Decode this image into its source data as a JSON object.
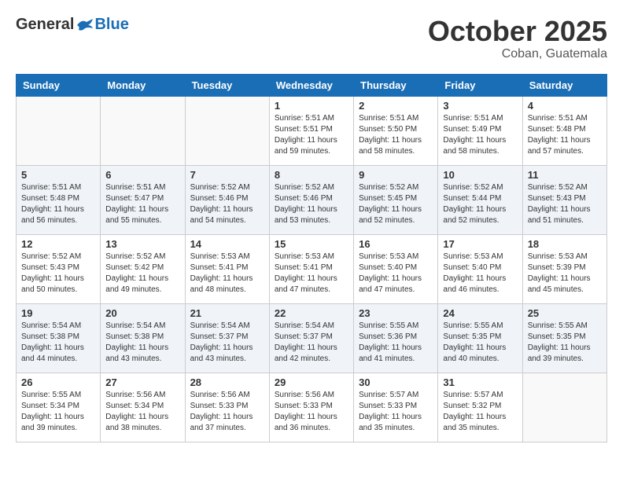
{
  "header": {
    "logo": {
      "general": "General",
      "blue": "Blue"
    },
    "title": "October 2025",
    "location": "Coban, Guatemala"
  },
  "weekdays": [
    "Sunday",
    "Monday",
    "Tuesday",
    "Wednesday",
    "Thursday",
    "Friday",
    "Saturday"
  ],
  "weeks": [
    [
      {
        "day": "",
        "info": ""
      },
      {
        "day": "",
        "info": ""
      },
      {
        "day": "",
        "info": ""
      },
      {
        "day": "1",
        "info": "Sunrise: 5:51 AM\nSunset: 5:51 PM\nDaylight: 11 hours\nand 59 minutes."
      },
      {
        "day": "2",
        "info": "Sunrise: 5:51 AM\nSunset: 5:50 PM\nDaylight: 11 hours\nand 58 minutes."
      },
      {
        "day": "3",
        "info": "Sunrise: 5:51 AM\nSunset: 5:49 PM\nDaylight: 11 hours\nand 58 minutes."
      },
      {
        "day": "4",
        "info": "Sunrise: 5:51 AM\nSunset: 5:48 PM\nDaylight: 11 hours\nand 57 minutes."
      }
    ],
    [
      {
        "day": "5",
        "info": "Sunrise: 5:51 AM\nSunset: 5:48 PM\nDaylight: 11 hours\nand 56 minutes."
      },
      {
        "day": "6",
        "info": "Sunrise: 5:51 AM\nSunset: 5:47 PM\nDaylight: 11 hours\nand 55 minutes."
      },
      {
        "day": "7",
        "info": "Sunrise: 5:52 AM\nSunset: 5:46 PM\nDaylight: 11 hours\nand 54 minutes."
      },
      {
        "day": "8",
        "info": "Sunrise: 5:52 AM\nSunset: 5:46 PM\nDaylight: 11 hours\nand 53 minutes."
      },
      {
        "day": "9",
        "info": "Sunrise: 5:52 AM\nSunset: 5:45 PM\nDaylight: 11 hours\nand 52 minutes."
      },
      {
        "day": "10",
        "info": "Sunrise: 5:52 AM\nSunset: 5:44 PM\nDaylight: 11 hours\nand 52 minutes."
      },
      {
        "day": "11",
        "info": "Sunrise: 5:52 AM\nSunset: 5:43 PM\nDaylight: 11 hours\nand 51 minutes."
      }
    ],
    [
      {
        "day": "12",
        "info": "Sunrise: 5:52 AM\nSunset: 5:43 PM\nDaylight: 11 hours\nand 50 minutes."
      },
      {
        "day": "13",
        "info": "Sunrise: 5:52 AM\nSunset: 5:42 PM\nDaylight: 11 hours\nand 49 minutes."
      },
      {
        "day": "14",
        "info": "Sunrise: 5:53 AM\nSunset: 5:41 PM\nDaylight: 11 hours\nand 48 minutes."
      },
      {
        "day": "15",
        "info": "Sunrise: 5:53 AM\nSunset: 5:41 PM\nDaylight: 11 hours\nand 47 minutes."
      },
      {
        "day": "16",
        "info": "Sunrise: 5:53 AM\nSunset: 5:40 PM\nDaylight: 11 hours\nand 47 minutes."
      },
      {
        "day": "17",
        "info": "Sunrise: 5:53 AM\nSunset: 5:40 PM\nDaylight: 11 hours\nand 46 minutes."
      },
      {
        "day": "18",
        "info": "Sunrise: 5:53 AM\nSunset: 5:39 PM\nDaylight: 11 hours\nand 45 minutes."
      }
    ],
    [
      {
        "day": "19",
        "info": "Sunrise: 5:54 AM\nSunset: 5:38 PM\nDaylight: 11 hours\nand 44 minutes."
      },
      {
        "day": "20",
        "info": "Sunrise: 5:54 AM\nSunset: 5:38 PM\nDaylight: 11 hours\nand 43 minutes."
      },
      {
        "day": "21",
        "info": "Sunrise: 5:54 AM\nSunset: 5:37 PM\nDaylight: 11 hours\nand 43 minutes."
      },
      {
        "day": "22",
        "info": "Sunrise: 5:54 AM\nSunset: 5:37 PM\nDaylight: 11 hours\nand 42 minutes."
      },
      {
        "day": "23",
        "info": "Sunrise: 5:55 AM\nSunset: 5:36 PM\nDaylight: 11 hours\nand 41 minutes."
      },
      {
        "day": "24",
        "info": "Sunrise: 5:55 AM\nSunset: 5:35 PM\nDaylight: 11 hours\nand 40 minutes."
      },
      {
        "day": "25",
        "info": "Sunrise: 5:55 AM\nSunset: 5:35 PM\nDaylight: 11 hours\nand 39 minutes."
      }
    ],
    [
      {
        "day": "26",
        "info": "Sunrise: 5:55 AM\nSunset: 5:34 PM\nDaylight: 11 hours\nand 39 minutes."
      },
      {
        "day": "27",
        "info": "Sunrise: 5:56 AM\nSunset: 5:34 PM\nDaylight: 11 hours\nand 38 minutes."
      },
      {
        "day": "28",
        "info": "Sunrise: 5:56 AM\nSunset: 5:33 PM\nDaylight: 11 hours\nand 37 minutes."
      },
      {
        "day": "29",
        "info": "Sunrise: 5:56 AM\nSunset: 5:33 PM\nDaylight: 11 hours\nand 36 minutes."
      },
      {
        "day": "30",
        "info": "Sunrise: 5:57 AM\nSunset: 5:33 PM\nDaylight: 11 hours\nand 35 minutes."
      },
      {
        "day": "31",
        "info": "Sunrise: 5:57 AM\nSunset: 5:32 PM\nDaylight: 11 hours\nand 35 minutes."
      },
      {
        "day": "",
        "info": ""
      }
    ]
  ]
}
